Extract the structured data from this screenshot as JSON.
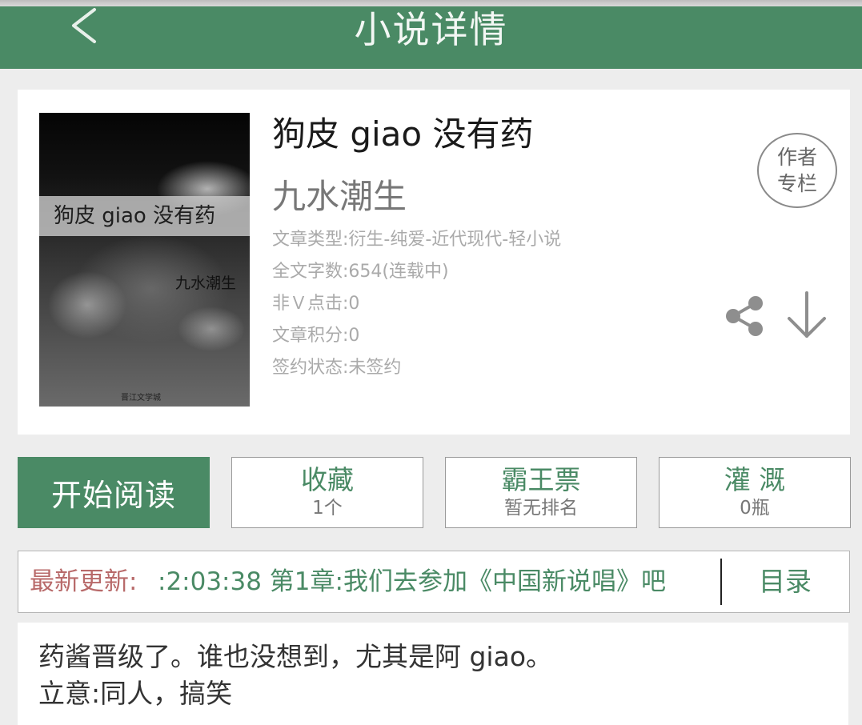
{
  "header": {
    "title": "小说详情",
    "back_icon": "chevron-left-icon",
    "background_color": "#4a8a65"
  },
  "book": {
    "title": "狗皮 giao 没有药",
    "author": "九水潮生",
    "cover": {
      "title": "狗皮 giao 没有药",
      "author": "九水潮生",
      "publisher": "晋江文学城"
    },
    "meta": [
      "文章类型:衍生-纯爱-近代现代-轻小说",
      "全文字数:654(连载中)",
      "非Ｖ点击:0",
      "文章积分:0",
      "签约状态:未签约"
    ],
    "author_column": {
      "line1": "作者",
      "line2": "专栏"
    },
    "share_icon": "share-icon",
    "download_icon": "download-arrow-icon"
  },
  "actions": {
    "read": "开始阅读",
    "favorite": {
      "label": "收藏",
      "value": "1个"
    },
    "ticket": {
      "label": "霸王票",
      "value": "暂无排名"
    },
    "nutrient": {
      "label": "灌 溉",
      "value": "0瓶"
    }
  },
  "latest_update": {
    "prefix": "最新更新:",
    "text": ":2:03:38   第1章:我们去参加《中国新说唱》吧",
    "toc": "目录"
  },
  "summary": {
    "line1": "药酱晋级了。谁也没想到，尤其是阿 giao。",
    "line2": "立意:同人，搞笑"
  },
  "colors": {
    "accent": "#4a8a65",
    "update_prefix": "#b86a6a",
    "meta_text": "#aaaaaa"
  }
}
